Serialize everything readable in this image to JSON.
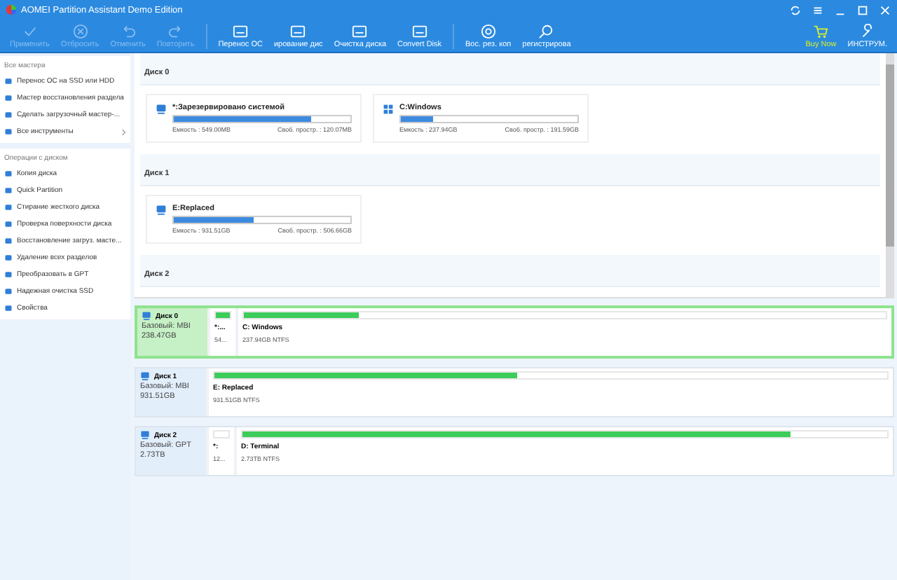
{
  "window": {
    "title": "AOMEI Partition Assistant Demo Edition"
  },
  "toolbar": {
    "items": [
      {
        "label": "Применить",
        "disabled": true,
        "kind": "check"
      },
      {
        "label": "Отбросить",
        "disabled": true,
        "kind": "discard"
      },
      {
        "label": "Отменить",
        "disabled": true,
        "kind": "undo"
      },
      {
        "label": "Повторить",
        "disabled": true,
        "kind": "redo"
      },
      {
        "label": "Перенос ОС",
        "disabled": false,
        "kind": "migrate"
      },
      {
        "label": "ирование дис",
        "disabled": false,
        "kind": "copy"
      },
      {
        "label": "Очистка диска",
        "disabled": false,
        "kind": "wipe"
      },
      {
        "label": "Convert Disk",
        "disabled": false,
        "kind": "convert"
      },
      {
        "label": "Вос. рез. коп",
        "disabled": false,
        "kind": "restore"
      },
      {
        "label": "регистрирова",
        "disabled": false,
        "kind": "search"
      }
    ],
    "right": [
      {
        "label": "Buy Now",
        "kind": "cart"
      },
      {
        "label": "ИНСТРУМ.",
        "kind": "tools"
      }
    ]
  },
  "sidebar": {
    "groups": [
      {
        "title": "Все мастера",
        "items": [
          {
            "label": "Перенос ОС на SSD или HDD",
            "chevron": false
          },
          {
            "label": "Мастер восстановления раздела",
            "chevron": false
          },
          {
            "label": "Сделать загрузочный мастер-...",
            "chevron": false
          },
          {
            "label": "Все инструменты",
            "chevron": true
          }
        ]
      },
      {
        "title": "Операции с диском",
        "items": [
          {
            "label": "Копия диска",
            "chevron": false
          },
          {
            "label": "Quick Partition",
            "chevron": false
          },
          {
            "label": "Стирание жесткого диска",
            "chevron": false
          },
          {
            "label": "Проверка поверхности диска",
            "chevron": false
          },
          {
            "label": "Восстановление загруз. масте...",
            "chevron": false
          },
          {
            "label": "Удаление всех разделов",
            "chevron": false
          },
          {
            "label": "Преобразовать в GPT",
            "chevron": false
          },
          {
            "label": "Надежная очистка SSD",
            "chevron": false
          },
          {
            "label": "Свойства",
            "chevron": false
          }
        ]
      }
    ]
  },
  "disk_cards": [
    {
      "title": "Диск 0",
      "partitions": [
        {
          "name": "*:Зарезервировано системой",
          "kind": "drive",
          "level": 0.78,
          "capacity": "Емкость : 549.00MB",
          "free": "Своб. простр. : 120.07MB"
        },
        {
          "name": "C:Windows",
          "kind": "windows",
          "level": 0.18,
          "capacity": "Емкость : 237.94GB",
          "free": "Своб. простр. : 191.59GB"
        }
      ]
    },
    {
      "title": "Диск 1",
      "partitions": [
        {
          "name": "E:Replaced",
          "kind": "drive",
          "level": 0.45,
          "capacity": "Емкость : 931.51GB",
          "free": "Своб. простр. : 506.66GB"
        }
      ]
    },
    {
      "title": "Диск 2"
    }
  ],
  "disk_map": [
    {
      "name": "Диск 0",
      "type": "Базовый: MBI",
      "size": "238.47GB",
      "selected": true,
      "partitions": [
        {
          "name": "*:...",
          "info": "54...",
          "level": 1,
          "small": true
        },
        {
          "name": "C: Windows",
          "info": "237.94GB NTFS",
          "level": 0.18,
          "small": false
        }
      ]
    },
    {
      "name": "Диск 1",
      "type": "Базовый: MBI",
      "size": "931.51GB",
      "selected": false,
      "partitions": [
        {
          "name": "E: Replaced",
          "info": "931.51GB NTFS",
          "level": 0.45,
          "small": false
        }
      ]
    },
    {
      "name": "Диск 2",
      "type": "Базовый: GPT",
      "size": "2.73TB",
      "selected": false,
      "partitions": [
        {
          "name": "*:",
          "info": "12...",
          "small": true
        },
        {
          "name": "D: Terminal",
          "info": "2.73TB NTFS",
          "level": 0.85,
          "small": false
        }
      ]
    }
  ]
}
